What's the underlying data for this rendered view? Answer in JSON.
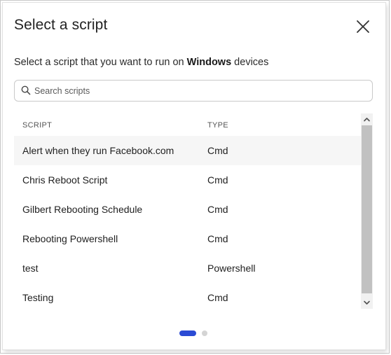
{
  "dialog": {
    "title": "Select a script",
    "close_icon": "close-icon"
  },
  "subtitle": {
    "prefix": "Select a script that you want to run on ",
    "platform": "Windows",
    "suffix": " devices"
  },
  "search": {
    "placeholder": "Search scripts",
    "value": "",
    "icon": "search-icon"
  },
  "table": {
    "columns": {
      "script": "SCRIPT",
      "type": "TYPE"
    },
    "rows": [
      {
        "script": "Alert when they run Facebook.com",
        "type": "Cmd"
      },
      {
        "script": "Chris Reboot Script",
        "type": "Cmd"
      },
      {
        "script": "Gilbert Rebooting Schedule",
        "type": "Cmd"
      },
      {
        "script": "Rebooting Powershell",
        "type": "Cmd"
      },
      {
        "script": "test",
        "type": "Powershell"
      },
      {
        "script": "Testing",
        "type": "Cmd"
      }
    ]
  },
  "pagination": {
    "pages": 2,
    "current": 1
  },
  "colors": {
    "accent": "#2b4bd4",
    "row_hover": "#f6f6f6",
    "scroll_thumb": "#c1c1c1"
  }
}
